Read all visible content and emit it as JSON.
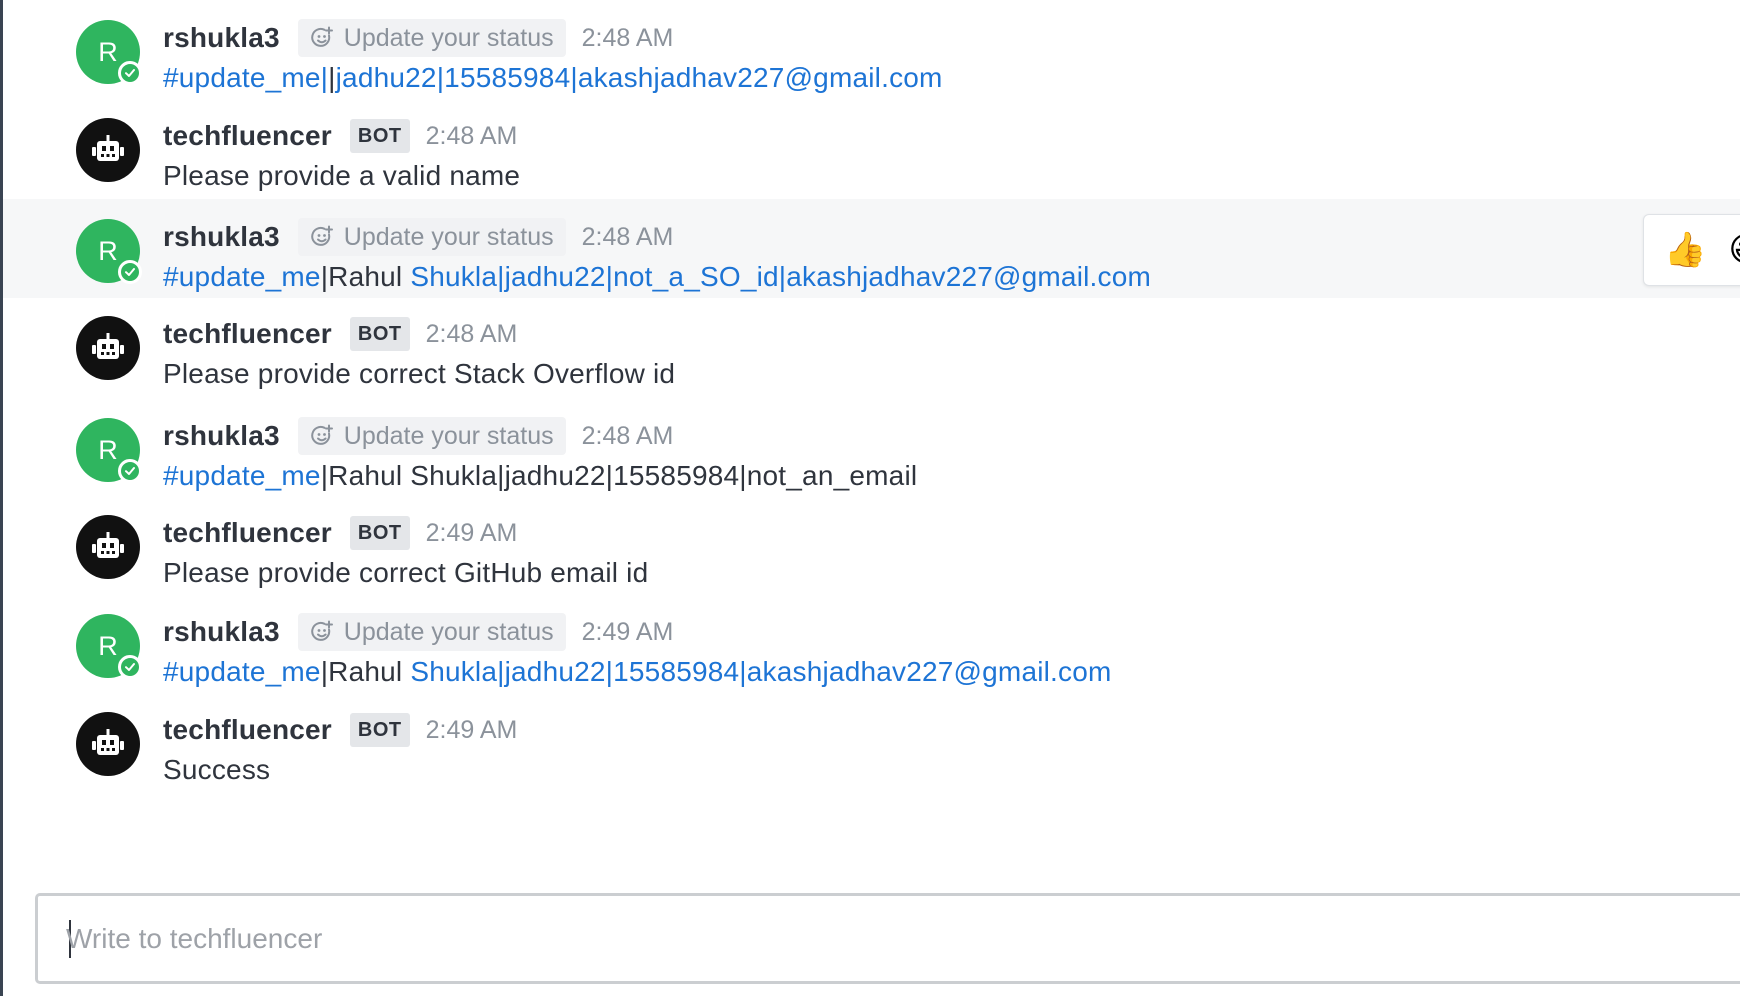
{
  "messages": [
    {
      "sender": "rshukla3",
      "type": "user",
      "avatar_initial": "R",
      "status_label": "Update your status",
      "time": "2:48 AM",
      "parts": [
        {
          "text": "#update_me|",
          "link": true
        },
        {
          "text": "|",
          "link": false
        },
        {
          "text": "jadhu22|15585984|akashjadhav227@gmail.com",
          "link": true
        }
      ]
    },
    {
      "sender": "techfluencer",
      "type": "bot",
      "badge": "BOT",
      "time": "2:48 AM",
      "parts": [
        {
          "text": "Please provide a valid name",
          "link": false
        }
      ]
    },
    {
      "sender": "rshukla3",
      "type": "user",
      "avatar_initial": "R",
      "status_label": "Update your status",
      "time": "2:48 AM",
      "hovered": true,
      "parts": [
        {
          "text": "#update_me",
          "link": true
        },
        {
          "text": "|Rahul ",
          "link": false
        },
        {
          "text": "Shukla|jadhu22|not_a_SO_id|akashjadhav227@gmail.com",
          "link": true
        }
      ]
    },
    {
      "sender": "techfluencer",
      "type": "bot",
      "badge": "BOT",
      "time": "2:48 AM",
      "parts": [
        {
          "text": "Please provide correct Stack Overflow id",
          "link": false
        }
      ]
    },
    {
      "sender": "rshukla3",
      "type": "user",
      "avatar_initial": "R",
      "status_label": "Update your status",
      "time": "2:48 AM",
      "parts": [
        {
          "text": "#update_me",
          "link": true
        },
        {
          "text": "|Rahul Shukla|jadhu22|15585984|not_an_email",
          "link": false
        }
      ]
    },
    {
      "sender": "techfluencer",
      "type": "bot",
      "badge": "BOT",
      "time": "2:49 AM",
      "parts": [
        {
          "text": "Please provide correct GitHub email id",
          "link": false
        }
      ]
    },
    {
      "sender": "rshukla3",
      "type": "user",
      "avatar_initial": "R",
      "status_label": "Update your status",
      "time": "2:49 AM",
      "parts": [
        {
          "text": "#update_me",
          "link": true
        },
        {
          "text": "|Rahul ",
          "link": false
        },
        {
          "text": "Shukla|jadhu22|15585984|akashjadhav227@gmail.com",
          "link": true
        }
      ]
    },
    {
      "sender": "techfluencer",
      "type": "bot",
      "badge": "BOT",
      "time": "2:49 AM",
      "parts": [
        {
          "text": "Success",
          "link": false
        }
      ]
    }
  ],
  "reaction_toolbar": {
    "reactions": [
      "👍",
      "😀"
    ]
  },
  "composer": {
    "placeholder": "Write to techfluencer",
    "value": ""
  },
  "colors": {
    "user_avatar": "#2fb55f",
    "bot_avatar": "#111111",
    "link": "#1d74d5",
    "text": "#2f343d",
    "muted": "#8b929b"
  },
  "icons": {
    "status": "smiley-plus-icon",
    "presence": "online-check-icon",
    "bot_avatar": "robot-icon"
  }
}
